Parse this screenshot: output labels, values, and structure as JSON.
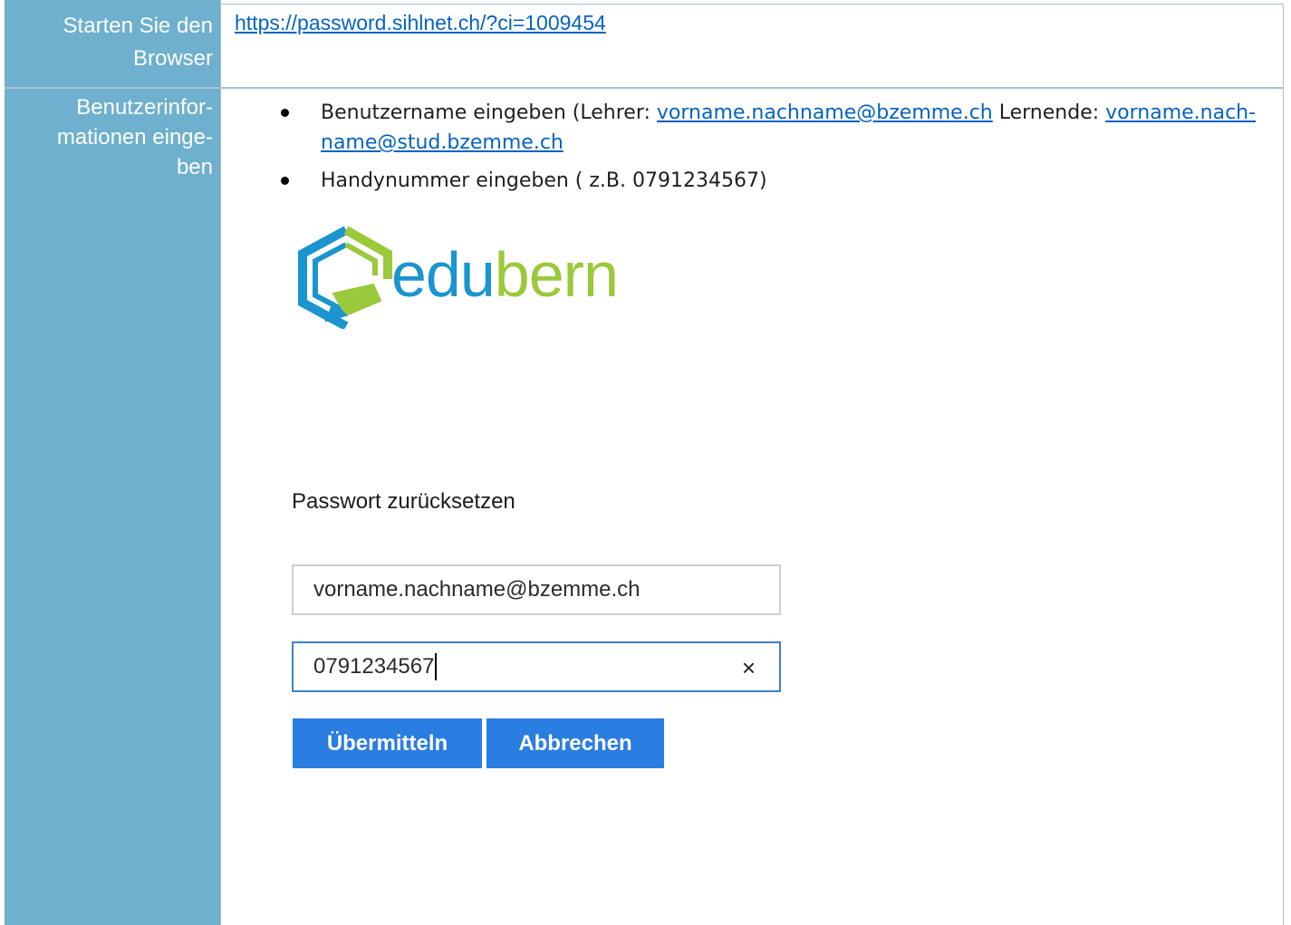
{
  "rows": [
    {
      "label": "Starten Sie den Browser",
      "label_lines": [
        "Starten Sie den",
        "Browser"
      ]
    },
    {
      "label_lines": [
        "Benutzerinfor-",
        "mationen einge-",
        "ben"
      ]
    }
  ],
  "url": "https://password.sihlnet.ch/?ci=1009454",
  "bullets": {
    "item1_prefix": "Benutzername eingeben (Lehrer: ",
    "item1_link1": "vorname.nachname@bzemme.ch",
    "item1_middle": " Lernende: ",
    "item1_link2_line1": "vorname.nach-",
    "item1_link2_line2": "name@stud.bzemme.ch",
    "item2": "Handynummer eingeben ( z.B. 0791234567)"
  },
  "logo": {
    "part1": "edu",
    "part2": "bern",
    "color_edu": "#1a95cf",
    "color_bern": "#9bc93c"
  },
  "form": {
    "title": "Passwort zurücksetzen",
    "email_value": "vorname.nachname@bzemme.ch",
    "phone_value": "0791234567",
    "clear_glyph": "×",
    "submit_label": "Übermitteln",
    "cancel_label": "Abbrechen"
  },
  "colors": {
    "sidebar": "#6eb0cd",
    "link": "#0563c1",
    "button": "#2a7de1"
  }
}
